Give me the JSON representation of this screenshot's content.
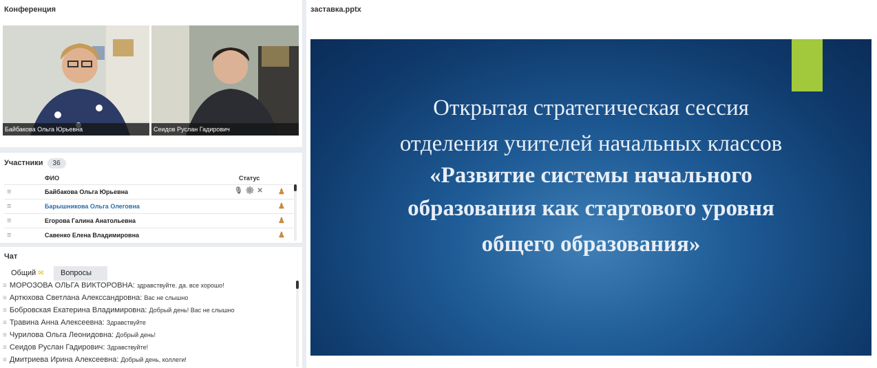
{
  "conference": {
    "title": "Конференция",
    "videos": [
      {
        "name": "Байбакова Ольга Юрьевна"
      },
      {
        "name": "Сеидов  Руслан   Гадирович"
      }
    ]
  },
  "participants": {
    "title": "Участники",
    "count": "36",
    "col_name": "ФИО",
    "col_status": "Статус",
    "rows": [
      {
        "name": "Байбакова Ольга Юрьевна"
      },
      {
        "name": "Барышникова Ольга  Олеговна"
      },
      {
        "name": "Егорова  Галина   Анатольевна"
      },
      {
        "name": "Савенко  Елена  Владимировна"
      }
    ]
  },
  "chat": {
    "title": "Чат",
    "tab_general": "Общий",
    "tab_questions": "Вопросы",
    "messages": [
      {
        "author": "МОРОЗОВА ОЛЬГА  ВИКТОРОВНА:",
        "text": "здравствуйте. да. все хорошо!"
      },
      {
        "author": "Артюхова Светлана  Алекссандровна:",
        "text": "Вас не слышно"
      },
      {
        "author": "Бобровская Екатерина  Владимировна:",
        "text": "Добрый день! Вас не слышно"
      },
      {
        "author": "Травина  Анна  Алексеевна:",
        "text": "Здравствуйте"
      },
      {
        "author": "Чурилова Ольга Леонидовна:",
        "text": "Добрый день!"
      },
      {
        "author": "Сеидов  Руслан   Гадирович:",
        "text": "Здравствуйте!"
      },
      {
        "author": "Дмитриева  Ирина  Алексеевна:",
        "text": "Добрый день, коллеги!"
      }
    ]
  },
  "presentation": {
    "title": "заставка.pptx",
    "slide": {
      "line1": "Открытая стратегическая сессия",
      "line2": "отделения учителей начальных классов",
      "bold1": "«Развитие системы начального",
      "bold2": "образования как стартового уровня",
      "bold3": "общего образования»"
    }
  },
  "colors": {
    "slide_bg": "#1f5c97",
    "slide_accent": "#a2c83c",
    "link_blue": "#2a6ea8"
  }
}
